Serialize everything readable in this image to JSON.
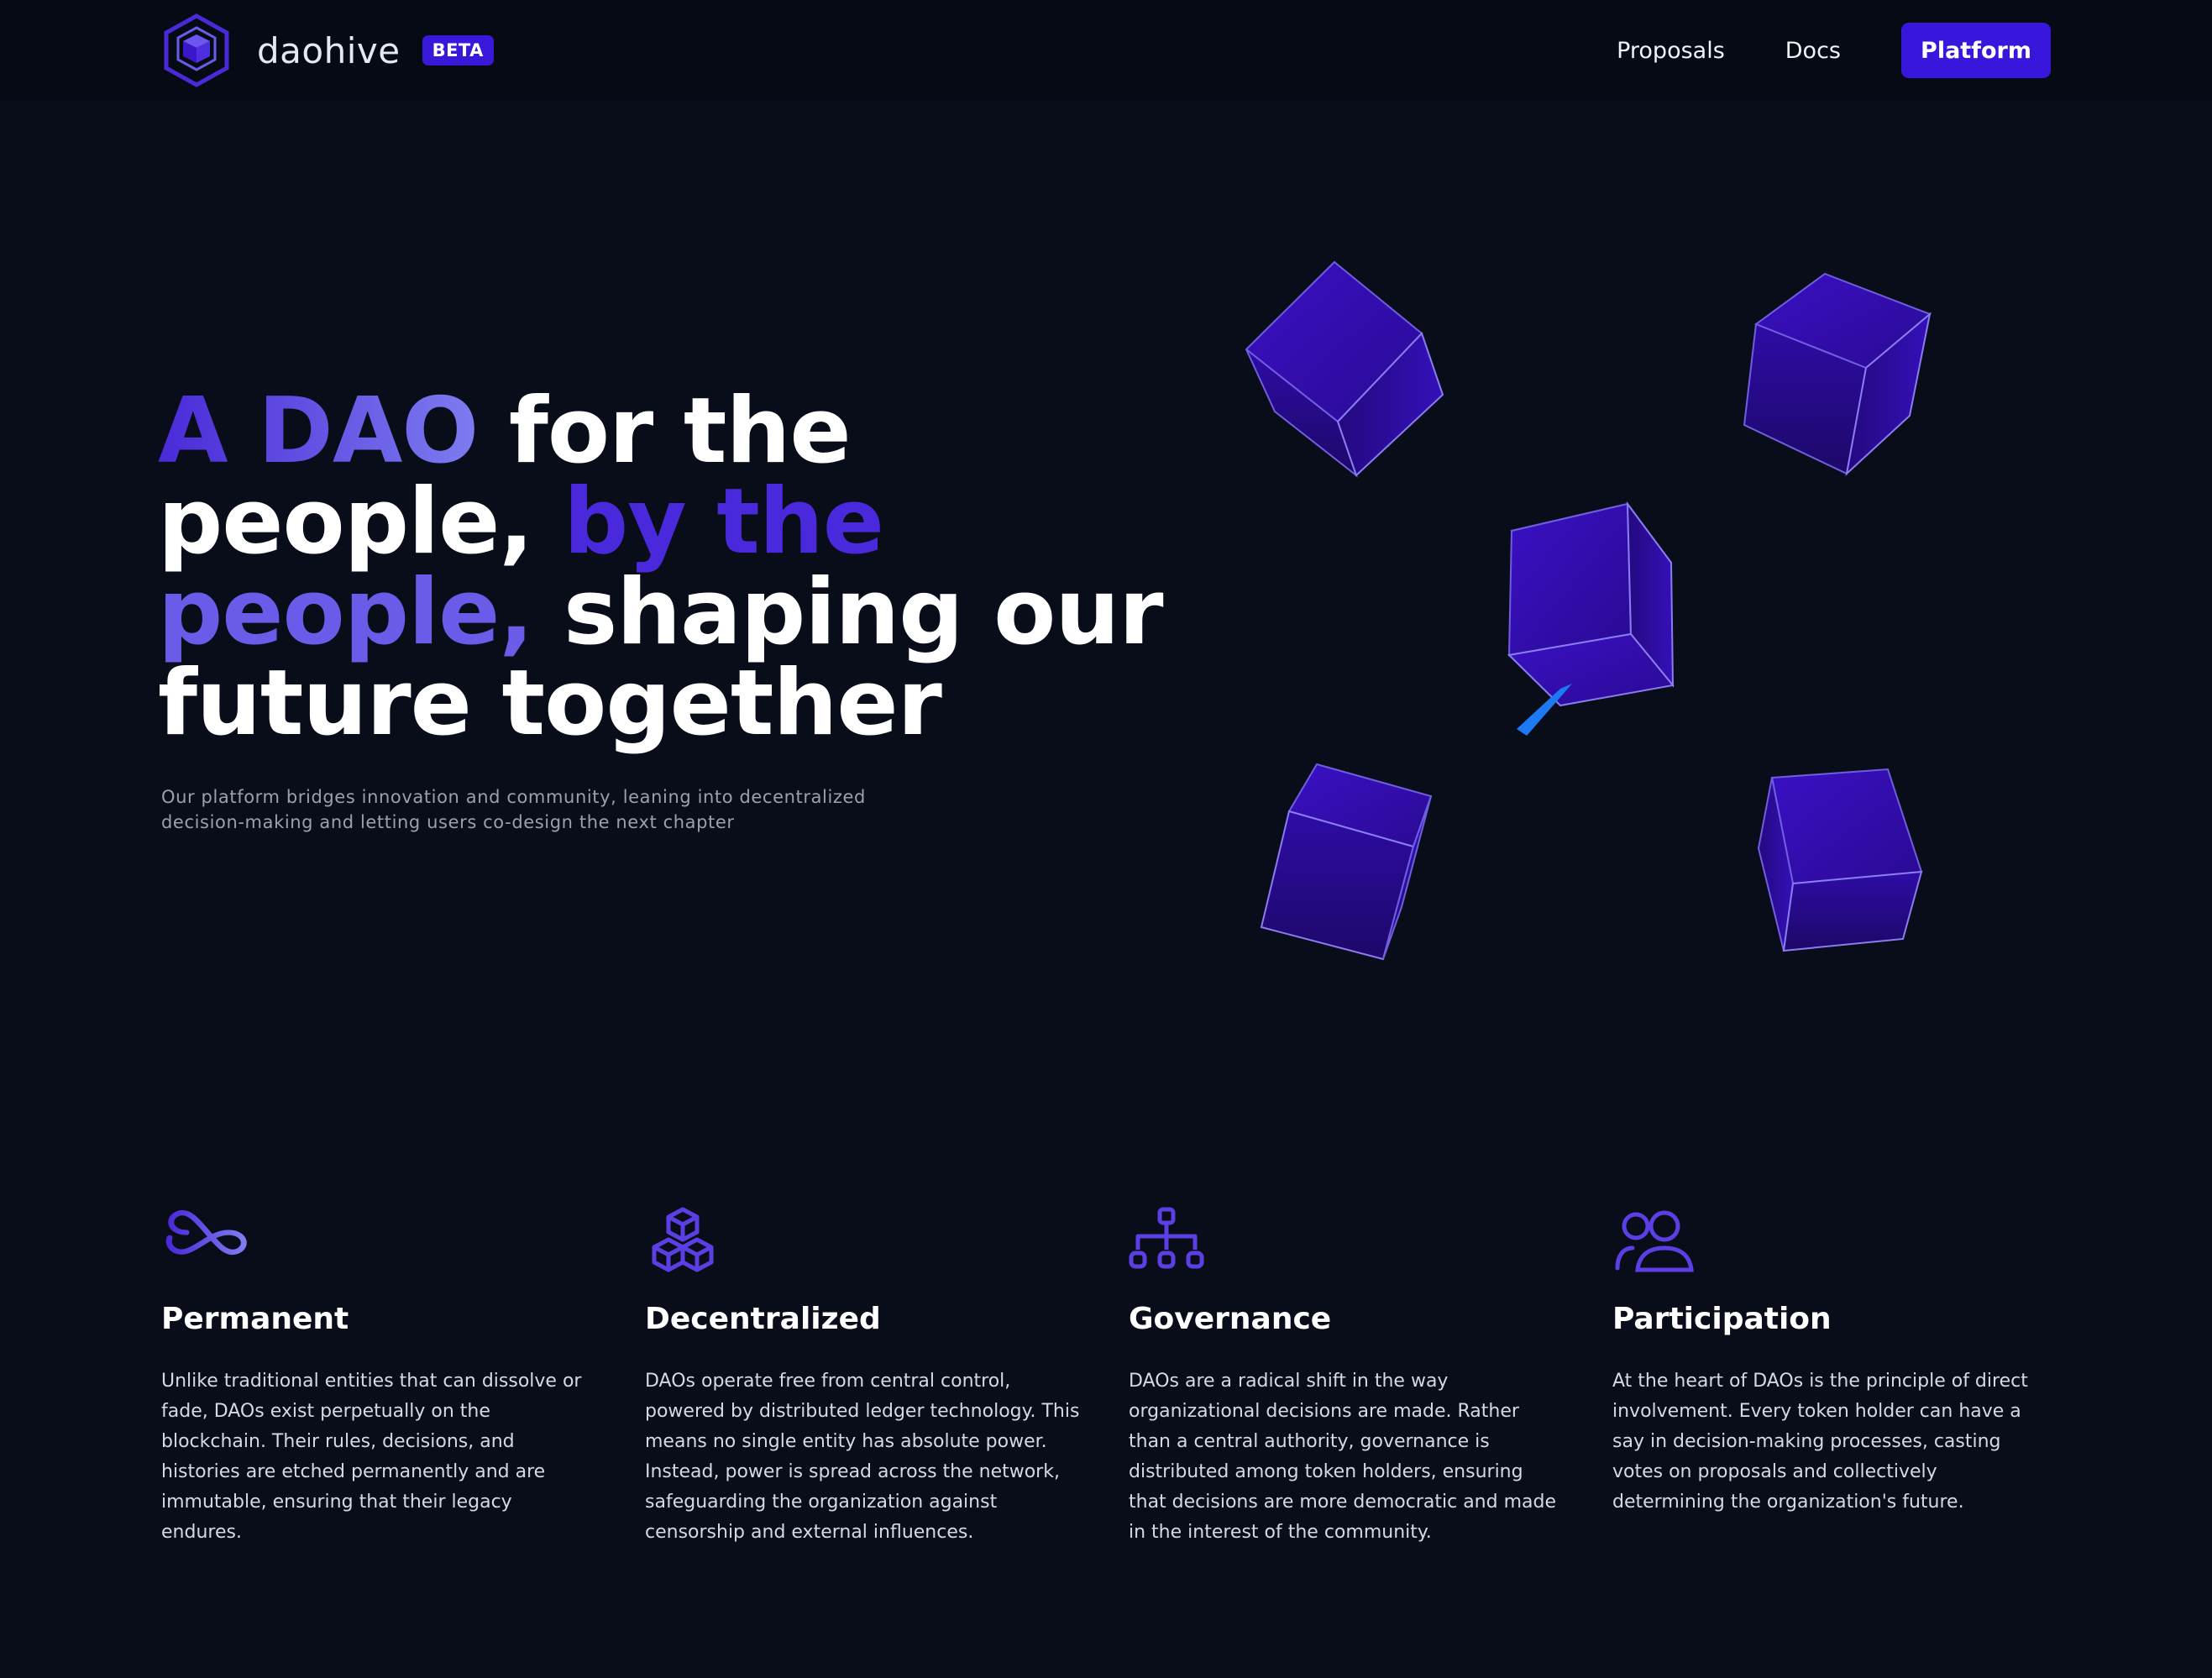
{
  "nav": {
    "brand_name": "daohive",
    "beta_badge": "BETA",
    "links": [
      "Proposals",
      "Docs"
    ],
    "cta_label": "Platform"
  },
  "hero": {
    "title_parts": [
      "A DAO",
      " for the people, ",
      "by the",
      " ",
      "people,",
      " shaping our future together"
    ],
    "subtitle": "Our platform bridges innovation and community, leaning into decentralized decision-making and letting users co-design the next chapter"
  },
  "features": [
    {
      "icon": "infinity-icon",
      "title": "Permanent",
      "body": "Unlike traditional entities that can dissolve or fade, DAOs exist perpetually on the blockchain. Their rules, decisions, and histories are etched permanently and are immutable, ensuring that their legacy endures."
    },
    {
      "icon": "cubes-icon",
      "title": "Decentralized",
      "body": "DAOs operate free from central control, powered by distributed ledger technology. This means no single entity has absolute power. Instead, power is spread across the network, safeguarding the organization against censorship and external influences."
    },
    {
      "icon": "network-icon",
      "title": "Governance",
      "body": "DAOs are a radical shift in the way organizational decisions are made. Rather than a central authority, governance is distributed among token holders, ensuring that decisions are more democratic and made in the interest of the community."
    },
    {
      "icon": "users-icon",
      "title": "Participation",
      "body": "At the heart of DAOs is the principle of direct involvement. Every token holder can have a say in decision-making processes, casting votes on proposals and collectively determining the organization's future."
    }
  ],
  "colors": {
    "background": "#090d1a",
    "nav_background": "#060a15",
    "accent": "#3916dc",
    "accent_light": "#6a5ce8"
  }
}
